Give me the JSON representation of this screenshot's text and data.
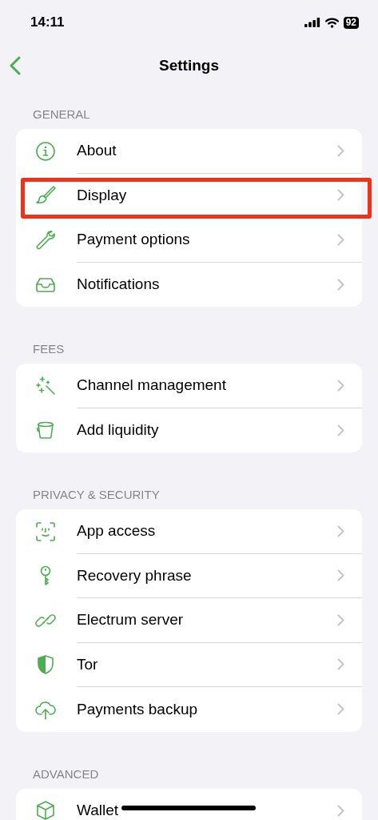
{
  "status_bar": {
    "time": "14:11",
    "battery": "92"
  },
  "nav": {
    "title": "Settings"
  },
  "sections": [
    {
      "header": "GENERAL",
      "items": [
        {
          "label": "About",
          "highlighted": false
        },
        {
          "label": "Display",
          "highlighted": true
        },
        {
          "label": "Payment options",
          "highlighted": false
        },
        {
          "label": "Notifications",
          "highlighted": false
        }
      ]
    },
    {
      "header": "FEES",
      "items": [
        {
          "label": "Channel management",
          "highlighted": false
        },
        {
          "label": "Add liquidity",
          "highlighted": false
        }
      ]
    },
    {
      "header": "PRIVACY & SECURITY",
      "items": [
        {
          "label": "App access",
          "highlighted": false
        },
        {
          "label": "Recovery phrase",
          "highlighted": false
        },
        {
          "label": "Electrum server",
          "highlighted": false
        },
        {
          "label": "Tor",
          "highlighted": false
        },
        {
          "label": "Payments backup",
          "highlighted": false
        }
      ]
    },
    {
      "header": "ADVANCED",
      "items": [
        {
          "label": "Wallet",
          "highlighted": false
        }
      ]
    }
  ]
}
